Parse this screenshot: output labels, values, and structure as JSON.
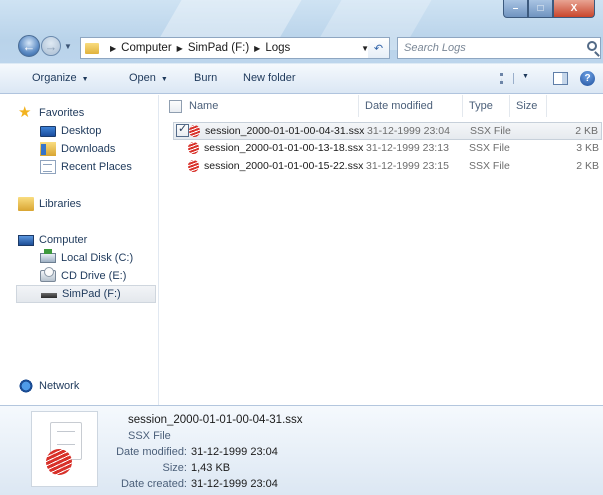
{
  "window": {
    "buttons": {
      "minimize": "–",
      "maximize": "□",
      "close": "X"
    }
  },
  "address": {
    "segments": [
      "Computer",
      "SimPad (F:)",
      "Logs"
    ],
    "search_placeholder": "Search Logs"
  },
  "toolbar": {
    "organize": "Organize",
    "open": "Open",
    "burn": "Burn",
    "new_folder": "New folder",
    "help": "?"
  },
  "navpane": {
    "favorites": "Favorites",
    "desktop": "Desktop",
    "downloads": "Downloads",
    "recent_places": "Recent Places",
    "libraries": "Libraries",
    "computer": "Computer",
    "local_disk": "Local Disk (C:)",
    "cd_drive": "CD Drive (E:)",
    "simpad": "SimPad (F:)",
    "network": "Network"
  },
  "columns": {
    "name": "Name",
    "date_modified": "Date modified",
    "type": "Type",
    "size": "Size"
  },
  "files": [
    {
      "name": "session_2000-01-01-00-04-31.ssx",
      "date": "31-12-1999 23:04",
      "type": "SSX File",
      "size": "2 KB",
      "selected": true
    },
    {
      "name": "session_2000-01-01-00-13-18.ssx",
      "date": "31-12-1999 23:13",
      "type": "SSX File",
      "size": "3 KB",
      "selected": false
    },
    {
      "name": "session_2000-01-01-00-15-22.ssx",
      "date": "31-12-1999 23:15",
      "type": "SSX File",
      "size": "2 KB",
      "selected": false
    }
  ],
  "details": {
    "filename": "session_2000-01-01-00-04-31.ssx",
    "type": "SSX File",
    "date_modified_label": "Date modified:",
    "date_modified": "31-12-1999 23:04",
    "size_label": "Size:",
    "size": "1,43 KB",
    "date_created_label": "Date created:",
    "date_created": "31-12-1999 23:04"
  },
  "colors": {
    "selection": "#e6eaef",
    "ssx_icon": "#d8312a",
    "chrome": "#bcd5ec"
  }
}
